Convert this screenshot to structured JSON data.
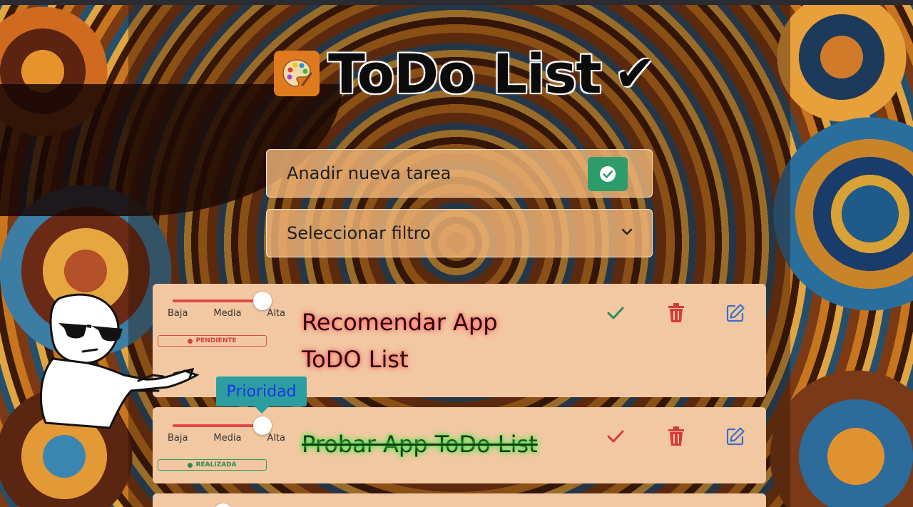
{
  "header": {
    "title": "ToDo List",
    "title_mark": "✔"
  },
  "add_field": {
    "label": "Anadir nueva tarea"
  },
  "filter_field": {
    "label": "Seleccionar filtro"
  },
  "tooltip": {
    "text": "Prioridad"
  },
  "slider_labels": [
    "Baja",
    "Media",
    "Alta"
  ],
  "tasks": [
    {
      "text": "Recomendar App ToDO List",
      "status": "PENDIENTE",
      "priority": "Alta"
    },
    {
      "text": "Probar App ToDo List",
      "status": "REALIZADA",
      "priority": "Alta"
    }
  ],
  "colors": {
    "accent_green": "#2e9c6a",
    "delete_red": "#d43c3c",
    "edit_blue": "#3a6fc9",
    "card_bg": "#f2c8a2",
    "tooltip_bg": "#2c9ea0"
  },
  "icons": [
    "palette-icon",
    "check-circle-icon",
    "chevron-down-icon",
    "check-icon",
    "trash-icon",
    "edit-icon"
  ]
}
